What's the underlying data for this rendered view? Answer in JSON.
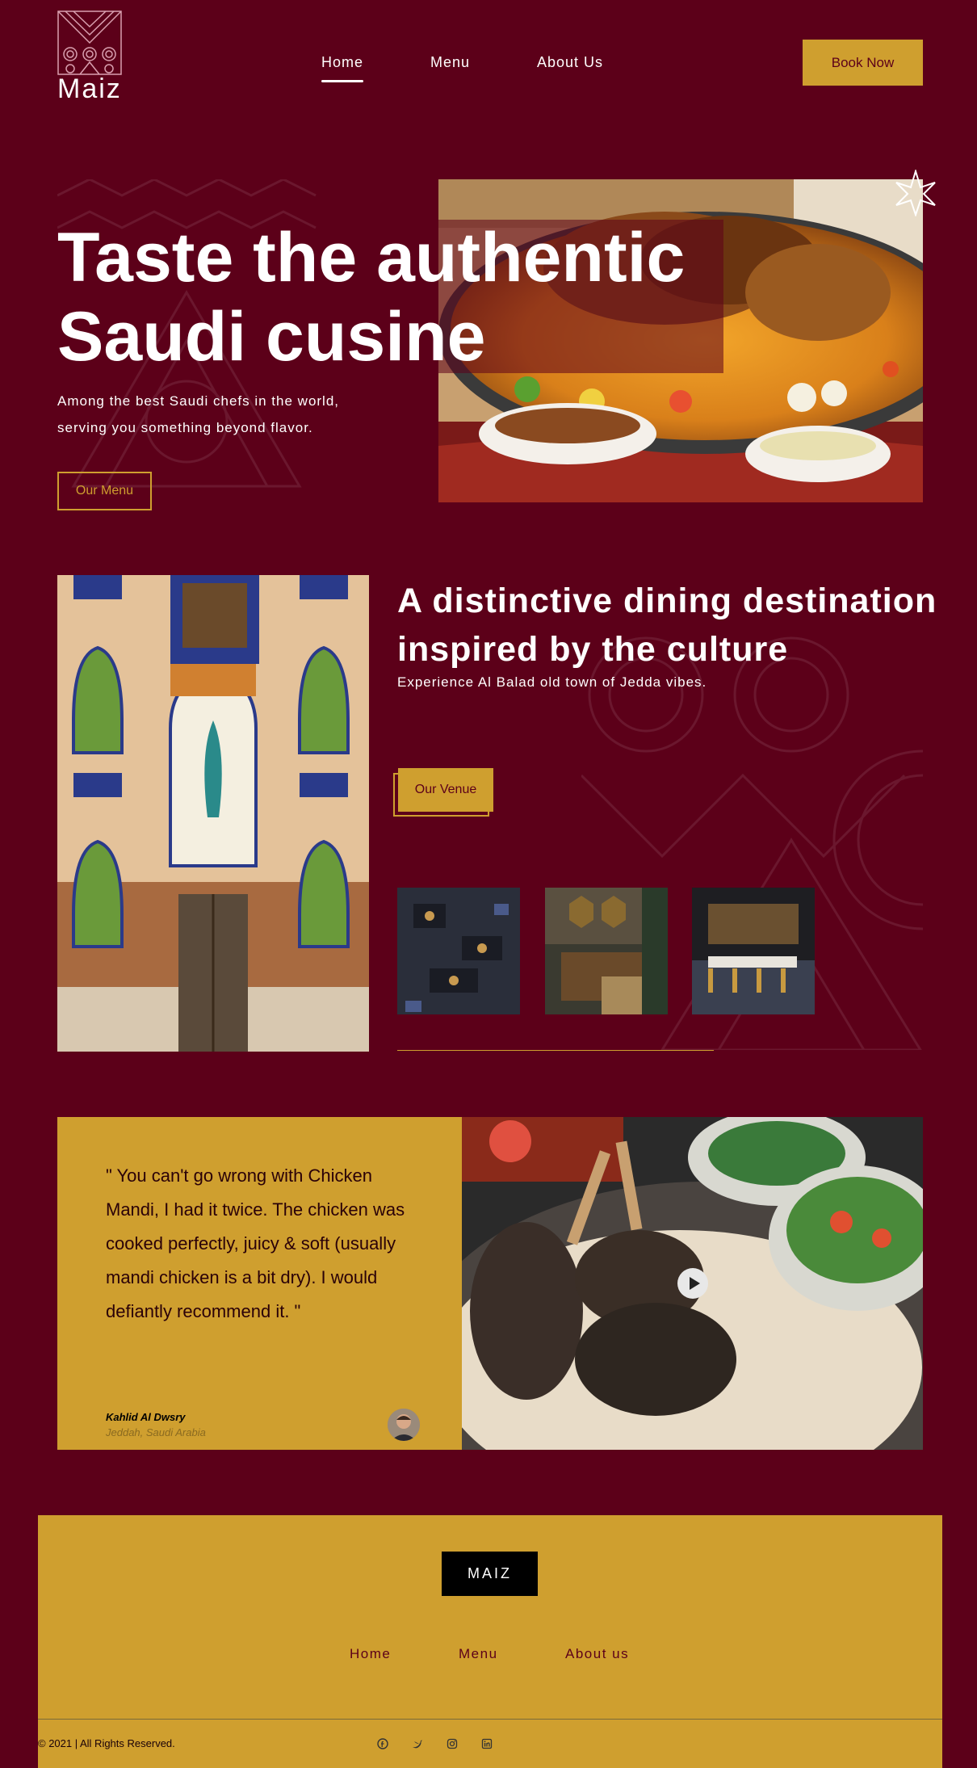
{
  "brand": {
    "name": "Maiz",
    "footer_name": "MAIZ"
  },
  "nav": {
    "home": "Home",
    "menu": "Menu",
    "about": "About Us",
    "book": "Book Now"
  },
  "hero": {
    "title": "Taste the authentic Saudi cusine",
    "subtitle": "Among the best Saudi chefs in the world, serving you something beyond flavor.",
    "button": "Our Menu"
  },
  "venue": {
    "title": "A distinctive dining destination inspired by the culture",
    "subtitle": "Experience Al Balad old town of Jedda vibes.",
    "button": "Our Venue"
  },
  "testimonial": {
    "quote": "\" You can't go wrong with Chicken Mandi, I had it twice. The chicken was cooked perfectly, juicy & soft (usually mandi chicken is a bit dry). I would defiantly recommend it. \"",
    "author": "Kahlid Al Dwsry",
    "location": "Jeddah, Saudi Arabia"
  },
  "footer": {
    "nav": {
      "home": "Home",
      "menu": "Menu",
      "about": "About us"
    },
    "copyright": "© 2021 | All Rights Reserved.",
    "social": [
      "facebook-icon",
      "twitter-icon",
      "instagram-icon",
      "linkedin-icon"
    ]
  },
  "colors": {
    "background": "#5c0019",
    "accent": "#cf9f2f",
    "text": "#ffffff"
  }
}
